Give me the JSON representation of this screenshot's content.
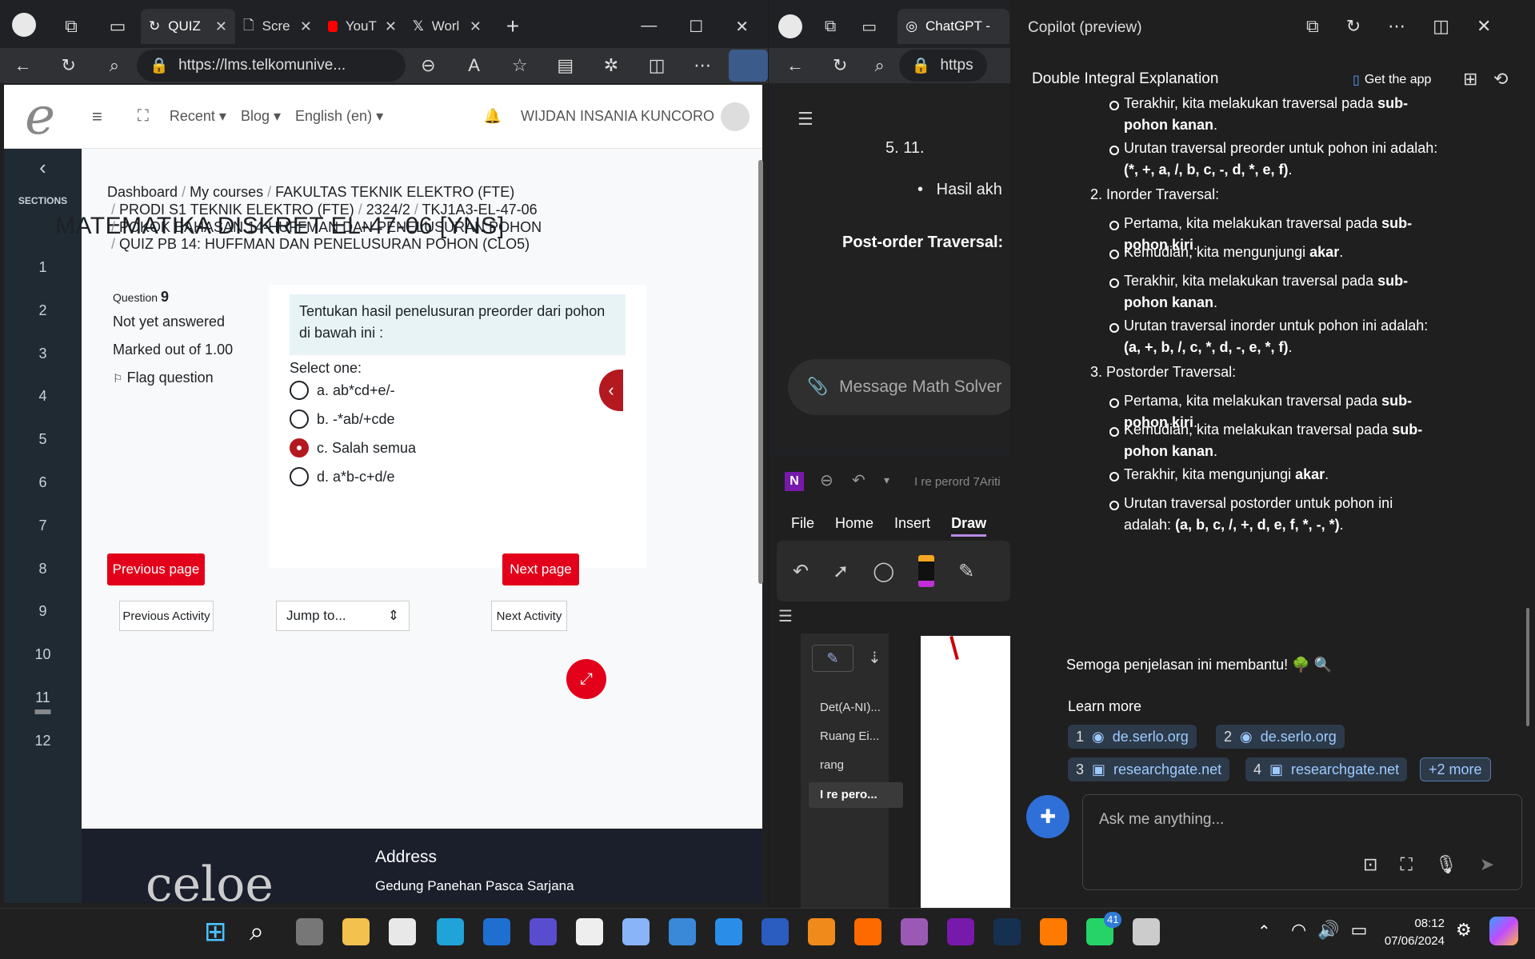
{
  "browser_left": {
    "tabs": [
      {
        "label": "QUIZ",
        "active": true
      },
      {
        "label": "Scre"
      },
      {
        "label": "YouT"
      },
      {
        "label": "Worl"
      }
    ],
    "url": "https://lms.telkomunive..."
  },
  "lms": {
    "nav": {
      "recent": "Recent",
      "blog": "Blog",
      "language": "English (en)",
      "user": "WIJDAN INSANIA KUNCORO"
    },
    "rail": {
      "title": "SECTIONS",
      "numbers": [
        "1",
        "2",
        "3",
        "4",
        "5",
        "6",
        "7",
        "8",
        "9",
        "10",
        "11",
        "12"
      ]
    },
    "course_title": "MATEMATIKA DISKRET EL-47-06 [YNS]",
    "breadcrumb": {
      "line1": [
        "Dashboard",
        "My courses",
        "FAKULTAS TEKNIK ELEKTRO (FTE)"
      ],
      "line2": [
        "PRODI S1 TEKNIK ELEKTRO (FTE)",
        "2324/2",
        "TKJ1A3-EL-47-06"
      ],
      "line3": [
        "POKOK BAHASAN 14-HUFFMAN DAN PENELUSURAN POHON"
      ],
      "line4": [
        "QUIZ PB 14: HUFFMAN DAN PENELUSURAN POHON (CLO5)"
      ]
    },
    "question": {
      "label": "Question",
      "number": "9",
      "status": "Not yet answered",
      "marks": "Marked out of 1.00",
      "flag": "Flag question",
      "text": "Tentukan hasil penelusuran preorder dari pohon di bawah ini :",
      "select_label": "Select one:",
      "options": [
        "a. ab*cd+e/-",
        "b. -*ab/+cde",
        "c. Salah semua",
        "d. a*b-c+d/e"
      ],
      "selected_index": 2
    },
    "buttons": {
      "prev_page": "Previous page",
      "next_page": "Next page",
      "prev_activity": "Previous Activity",
      "jump": "Jump to...",
      "next_activity": "Next Activity"
    },
    "footer": {
      "address_title": "Address",
      "address_line": "Gedung Panehan Pasca Sarjana"
    }
  },
  "browser_mid": {
    "tab_label": "ChatGPT -",
    "url": "https",
    "content": {
      "partial": "5.  11.",
      "bullet": "Hasil akh",
      "heading": "Post-order Traversal:"
    },
    "input_placeholder": "Message Math Solver"
  },
  "onenote": {
    "title": "I re perord 7Ariti",
    "menu": [
      "File",
      "Home",
      "Insert",
      "Draw"
    ],
    "active_menu": "Draw",
    "pages": [
      "Det(A-NI)...",
      "Ruang Ei...",
      "rang",
      "I re pero..."
    ]
  },
  "copilot": {
    "title": "Copilot (preview)",
    "conversation_title": "Double Integral Explanation",
    "get_app": "Get the app",
    "items": [
      {
        "type": "bullet",
        "text": "Terakhir, kita melakukan traversal pada ",
        "bold": "sub-pohon kanan",
        "tail": "."
      },
      {
        "type": "bullet",
        "text": "Urutan traversal preorder untuk pohon ini adalah: ",
        "bold": "(*, +, a, /, b, c, -, d, *, e, f)",
        "tail": "."
      },
      {
        "type": "heading",
        "text": "2. Inorder Traversal:"
      },
      {
        "type": "bullet",
        "text": "Pertama, kita melakukan traversal pada ",
        "bold": "sub-pohon kiri",
        "tail": "."
      },
      {
        "type": "bullet",
        "text": "Kemudian, kita mengunjungi ",
        "bold": "akar",
        "tail": "."
      },
      {
        "type": "bullet",
        "text": "Terakhir, kita melakukan traversal pada ",
        "bold": "sub-pohon kanan",
        "tail": "."
      },
      {
        "type": "bullet",
        "text": "Urutan traversal inorder untuk pohon ini adalah: ",
        "bold": "(a, +, b, /, c, *, d, -, e, *, f)",
        "tail": "."
      },
      {
        "type": "heading",
        "text": "3. Postorder Traversal:"
      },
      {
        "type": "bullet",
        "text": "Pertama, kita melakukan traversal pada ",
        "bold": "sub-pohon kiri",
        "tail": "."
      },
      {
        "type": "bullet",
        "text": "Kemudian, kita melakukan traversal pada ",
        "bold": "sub-pohon kanan",
        "tail": "."
      },
      {
        "type": "bullet",
        "text": "Terakhir, kita mengunjungi ",
        "bold": "akar",
        "tail": "."
      },
      {
        "type": "bullet",
        "text": "Urutan traversal postorder untuk pohon ini adalah: ",
        "bold": "(a, b, c, /, +, d, e, f, *, -, *)",
        "tail": "."
      }
    ],
    "closing": "Semoga penjelasan ini membantu! 🌳 🔍",
    "learn_more": "Learn more",
    "sources": [
      {
        "n": "1",
        "label": "de.serlo.org"
      },
      {
        "n": "2",
        "label": "de.serlo.org"
      },
      {
        "n": "3",
        "label": "researchgate.net"
      },
      {
        "n": "4",
        "label": "researchgate.net"
      }
    ],
    "more": "+2 more",
    "input_placeholder": "Ask me anything..."
  },
  "taskbar": {
    "time": "08:12",
    "date": "07/06/2024",
    "whatsapp_badge": "41"
  }
}
